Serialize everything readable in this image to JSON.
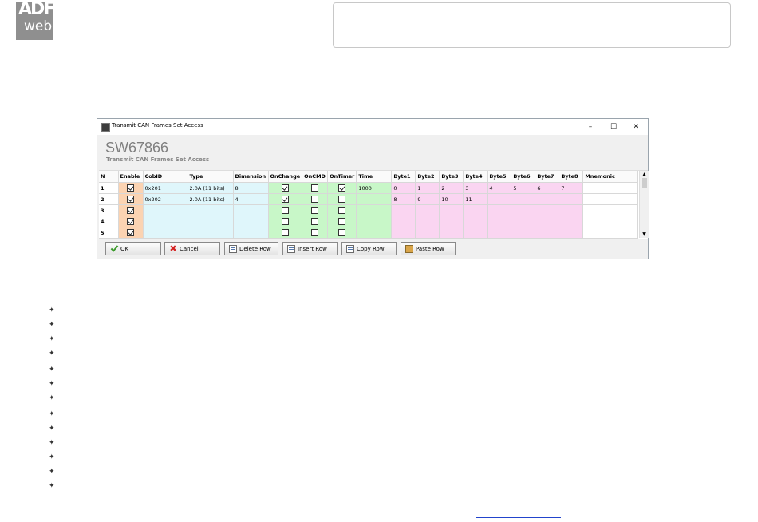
{
  "logo": {
    "top": "ADF",
    "bottom": "web"
  },
  "window": {
    "title": "Transmit CAN Frames Set Access",
    "controls": {
      "minimize": "–",
      "maximize": "☐",
      "close": "✕"
    },
    "product_code": "SW67866",
    "subtitle": "Transmit CAN Frames Set Access"
  },
  "table": {
    "columns": [
      "N",
      "Enable",
      "CobID",
      "Type",
      "Dimension",
      "OnChange",
      "OnCMD",
      "OnTimer",
      "Time",
      "Byte1",
      "Byte2",
      "Byte3",
      "Byte4",
      "Byte5",
      "Byte6",
      "Byte7",
      "Byte8",
      "Mnemonic"
    ],
    "rows": [
      {
        "n": "1",
        "enable": true,
        "cobid": "0x201",
        "type": "2.0A (11 bits)",
        "dim": "8",
        "onchange": true,
        "oncmd": false,
        "ontimer": true,
        "time": "1000",
        "bytes": [
          "0",
          "1",
          "2",
          "3",
          "4",
          "5",
          "6",
          "7"
        ],
        "mnemonic": ""
      },
      {
        "n": "2",
        "enable": true,
        "cobid": "0x202",
        "type": "2.0A (11 bits)",
        "dim": "4",
        "onchange": true,
        "oncmd": false,
        "ontimer": false,
        "time": "",
        "bytes": [
          "8",
          "9",
          "10",
          "11",
          "",
          "",
          "",
          ""
        ],
        "mnemonic": ""
      },
      {
        "n": "3",
        "enable": true,
        "cobid": "",
        "type": "",
        "dim": "",
        "onchange": false,
        "oncmd": false,
        "ontimer": false,
        "time": "",
        "bytes": [
          "",
          "",
          "",
          "",
          "",
          "",
          "",
          ""
        ],
        "mnemonic": ""
      },
      {
        "n": "4",
        "enable": true,
        "cobid": "",
        "type": "",
        "dim": "",
        "onchange": false,
        "oncmd": false,
        "ontimer": false,
        "time": "",
        "bytes": [
          "",
          "",
          "",
          "",
          "",
          "",
          "",
          ""
        ],
        "mnemonic": ""
      },
      {
        "n": "5",
        "enable": true,
        "cobid": "",
        "type": "",
        "dim": "",
        "onchange": false,
        "oncmd": false,
        "ontimer": false,
        "time": "",
        "bytes": [
          "",
          "",
          "",
          "",
          "",
          "",
          "",
          ""
        ],
        "mnemonic": ""
      }
    ]
  },
  "buttons": {
    "ok": "OK",
    "cancel": "Cancel",
    "delete_row": "Delete Row",
    "insert_row": "Insert Row",
    "copy_row": "Copy Row",
    "paste_row": "Paste Row"
  },
  "bullet_glyph": "✦"
}
